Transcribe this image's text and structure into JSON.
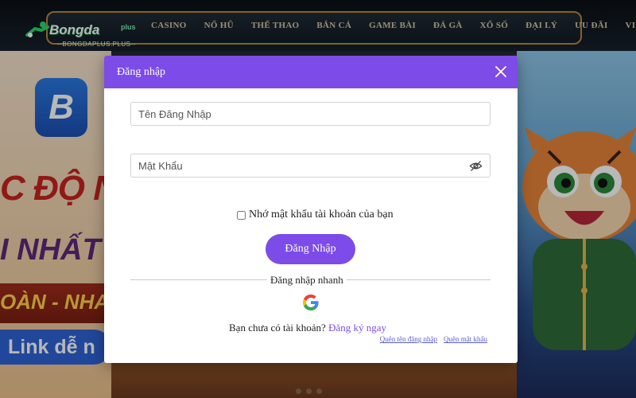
{
  "brand": {
    "logo_main": "Bongda",
    "logo_plus": "plus",
    "logo_sub": "--BONGDAPLUS.PLUS--"
  },
  "nav": {
    "items": [
      "CASINO",
      "NỔ HŨ",
      "THỂ THAO",
      "BẮN CÁ",
      "GAME BÀI",
      "ĐÁ GÀ",
      "XỔ SỐ",
      "ĐẠI LÝ",
      "ƯU ĐÃI",
      "VIP"
    ]
  },
  "background": {
    "text1": "C ĐỘ N",
    "text2": "I NHẤT",
    "text3": "OÀN - NHAN",
    "text4": "Link dễ n"
  },
  "modal": {
    "title": "Đăng nhập",
    "username_placeholder": "Tên Đăng Nhập",
    "password_placeholder": "Mật Khẩu",
    "remember_label": "Nhớ mật khẩu tài khoản của bạn",
    "login_button": "Đăng Nhập",
    "quick_login_label": "Đăng nhập nhanh",
    "signup_prompt": "Bạn chưa có tài khoản?",
    "signup_link": "Đăng ký ngay",
    "forgot_username": "Quên tên đăng nhập",
    "forgot_password": "Quên mật khẩu"
  },
  "colors": {
    "accent": "#7d4be8",
    "nav_border": "#b88740"
  },
  "icons": {
    "close": "close-icon",
    "eye": "eye-off-icon",
    "google": "google-icon"
  }
}
